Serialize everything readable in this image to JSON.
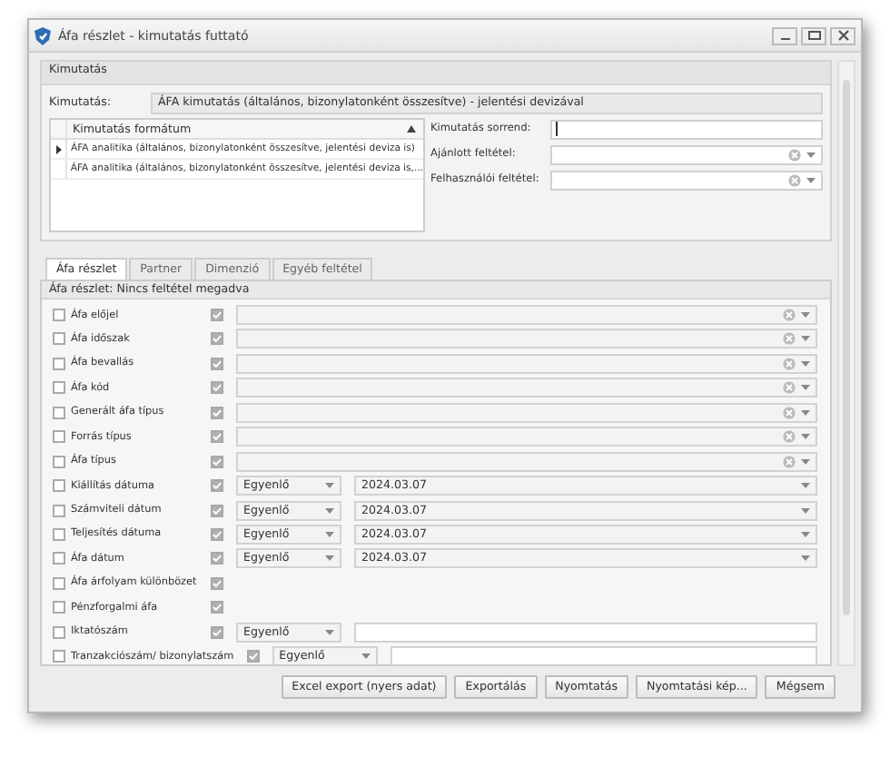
{
  "window": {
    "title": "Áfa részlet - kimutatás futtató"
  },
  "report_group": {
    "title": "Kimutatás",
    "label": "Kimutatás:",
    "value": "ÁFA kimutatás (általános, bizonylatonként összesítve) - jelentési devizával"
  },
  "formats": {
    "column": "Kimutatás formátum",
    "rows": [
      {
        "text": "ÁFA analitika (általános, bizonylatonként összesítve, jelentési deviza is)",
        "selected": true
      },
      {
        "text": "ÁFA analitika (általános, bizonylatonként összesítve, jelentési deviza is,...",
        "selected": false
      }
    ]
  },
  "settings": [
    {
      "label": "Kimutatás sorrend:",
      "kind": "text"
    },
    {
      "label": "Ajánlott feltétel:",
      "kind": "combo"
    },
    {
      "label": "Felhasználói feltétel:",
      "kind": "combo"
    }
  ],
  "tabs": [
    {
      "label": "Áfa részlet",
      "selected": true
    },
    {
      "label": "Partner",
      "selected": false
    },
    {
      "label": "Dimenzió",
      "selected": false
    },
    {
      "label": "Egyéb feltétel",
      "selected": false
    }
  ],
  "filter_summary": "Áfa részlet: Nincs feltétel megadva",
  "filters": [
    {
      "label": "Áfa előjel",
      "checked": false,
      "included": true,
      "kind": "lookup"
    },
    {
      "label": "Áfa időszak",
      "checked": false,
      "included": true,
      "kind": "lookup"
    },
    {
      "label": "Áfa bevallás",
      "checked": false,
      "included": true,
      "kind": "lookup"
    },
    {
      "label": "Áfa kód",
      "checked": false,
      "included": true,
      "kind": "lookup"
    },
    {
      "label": "Generált áfa típus",
      "checked": false,
      "included": true,
      "kind": "lookup"
    },
    {
      "label": "Forrás típus",
      "checked": false,
      "included": true,
      "kind": "lookup"
    },
    {
      "label": "Áfa típus",
      "checked": false,
      "included": true,
      "kind": "lookup"
    },
    {
      "label": "Kiállítás dátuma",
      "checked": false,
      "included": true,
      "kind": "date",
      "operator": "Egyenlő",
      "value": "2024.03.07"
    },
    {
      "label": "Számviteli dátum",
      "checked": false,
      "included": true,
      "kind": "date",
      "operator": "Egyenlő",
      "value": "2024.03.07"
    },
    {
      "label": "Teljesítés dátuma",
      "checked": false,
      "included": true,
      "kind": "date",
      "operator": "Egyenlő",
      "value": "2024.03.07"
    },
    {
      "label": "Áfa dátum",
      "checked": false,
      "included": true,
      "kind": "date",
      "operator": "Egyenlő",
      "value": "2024.03.07"
    },
    {
      "label": "Áfa árfolyam különbözet",
      "checked": false,
      "included": true,
      "kind": "flag"
    },
    {
      "label": "Pénzforgalmi áfa",
      "checked": false,
      "included": true,
      "kind": "flag"
    },
    {
      "label": "Iktatószám",
      "checked": false,
      "included": true,
      "kind": "text",
      "operator": "Egyenlő"
    },
    {
      "label": "Tranzakciószám/ bizonylatszám",
      "checked": false,
      "included": true,
      "kind": "text",
      "operator": "Egyenlő"
    }
  ],
  "buttons": [
    "Excel export (nyers adat)",
    "Exportálás",
    "Nyomtatás",
    "Nyomtatási kép...",
    "Mégsem"
  ]
}
